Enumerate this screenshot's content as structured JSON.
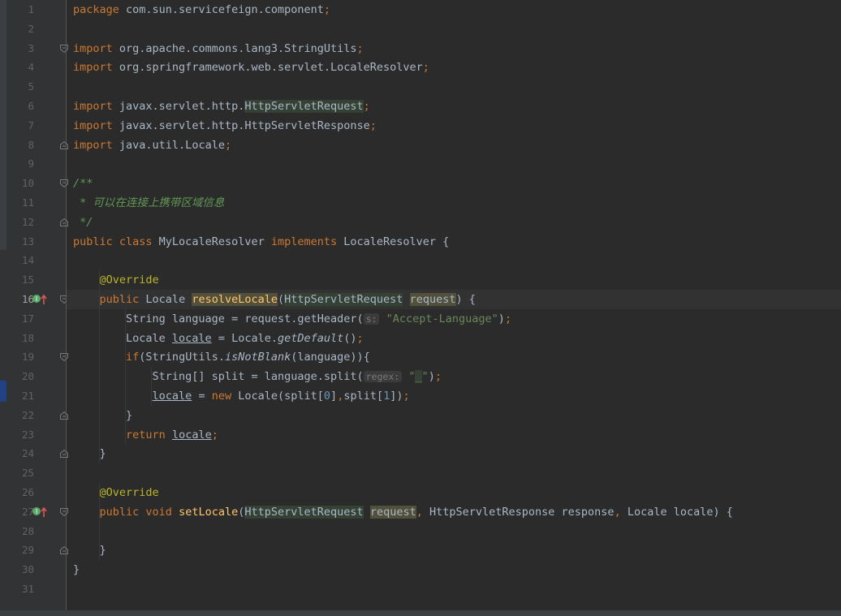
{
  "editor": {
    "current_line": 16,
    "lines": [
      {
        "n": "1",
        "html": "<span class=\"kw\">package</span> com.sun.servicefeign.component<span class=\"kw\">;</span>"
      },
      {
        "n": "2",
        "html": ""
      },
      {
        "n": "3",
        "html": "<span class=\"kw\">import</span> org.apache.commons.lang3.StringUtils<span class=\"kw\">;</span>"
      },
      {
        "n": "4",
        "html": "<span class=\"kw\">import</span> org.springframework.web.servlet.LocaleResolver<span class=\"kw\">;</span>"
      },
      {
        "n": "5",
        "html": ""
      },
      {
        "n": "6",
        "html": "<span class=\"kw\">import</span> javax.servlet.http.<span class=\"hl\">HttpServletRequest</span><span class=\"kw\">;</span>"
      },
      {
        "n": "7",
        "html": "<span class=\"kw\">import</span> javax.servlet.http.HttpServletResponse<span class=\"kw\">;</span>"
      },
      {
        "n": "8",
        "html": "<span class=\"kw\">import</span> java.util.Locale<span class=\"kw\">;</span>"
      },
      {
        "n": "9",
        "html": ""
      },
      {
        "n": "10",
        "html": "<span class=\"doc\">/**</span>"
      },
      {
        "n": "11",
        "html": "<span class=\"doc\"> * 可以在连接上携带区域信息</span>"
      },
      {
        "n": "12",
        "html": "<span class=\"doc\"> */</span>"
      },
      {
        "n": "13",
        "html": "<span class=\"kw\">public class</span> MyLocaleResolver <span class=\"kw\">implements</span> LocaleResolver {"
      },
      {
        "n": "14",
        "html": ""
      },
      {
        "n": "15",
        "html": "    <span class=\"ann\">@Override</span>"
      },
      {
        "n": "16",
        "html": "    <span class=\"kw\">public</span> Locale <span class=\"fn hl2\">resolveLocale</span>(<span class=\"hl\">HttpServletRequest</span> <span class=\"hl2\">request</span>) {"
      },
      {
        "n": "17",
        "html": "        String language = request.getHeader(<span class=\"hint\">s:</span> <span class=\"str\">\"Accept-Language\"</span>)<span class=\"kw\">;</span>"
      },
      {
        "n": "18",
        "html": "        Locale <span class=\"ul\">locale</span> = Locale.<span class=\"it\">getDefault</span>()<span class=\"kw\">;</span>"
      },
      {
        "n": "19",
        "html": "        <span class=\"kw\">if</span>(StringUtils.<span class=\"it\">isNotBlank</span>(language)){"
      },
      {
        "n": "20",
        "html": "            String[] split = language.split(<span class=\"hint\">regex:</span> <span class=\"str\">\"<span class=\"hl\">_</span>\"</span>)<span class=\"kw\">;</span>"
      },
      {
        "n": "21",
        "html": "            <span class=\"ul\">locale</span> = <span class=\"kw\">new</span> Locale(split[<span class=\"num\">0</span>]<span class=\"kw\">,</span>split[<span class=\"num\">1</span>])<span class=\"kw\">;</span>"
      },
      {
        "n": "22",
        "html": "        }"
      },
      {
        "n": "23",
        "html": "        <span class=\"kw\">return</span> <span class=\"ul\">locale</span><span class=\"kw\">;</span>"
      },
      {
        "n": "24",
        "html": "    }"
      },
      {
        "n": "25",
        "html": ""
      },
      {
        "n": "26",
        "html": "    <span class=\"ann\">@Override</span>"
      },
      {
        "n": "27",
        "html": "    <span class=\"kw\">public void</span> <span class=\"fn\">setLocale</span>(<span class=\"hl\">HttpServletRequest</span> <span class=\"hl2\">request</span><span class=\"kw\">,</span> HttpServletResponse response<span class=\"kw\">,</span> Locale locale) {"
      },
      {
        "n": "28",
        "html": ""
      },
      {
        "n": "29",
        "html": "    }"
      },
      {
        "n": "30",
        "html": "}"
      },
      {
        "n": "31",
        "html": ""
      }
    ],
    "fold_markers": [
      {
        "line": 3,
        "kind": "open"
      },
      {
        "line": 8,
        "kind": "close"
      },
      {
        "line": 10,
        "kind": "open"
      },
      {
        "line": 12,
        "kind": "close"
      },
      {
        "line": 16,
        "kind": "open"
      },
      {
        "line": 19,
        "kind": "open"
      },
      {
        "line": 22,
        "kind": "close"
      },
      {
        "line": 24,
        "kind": "close"
      },
      {
        "line": 27,
        "kind": "open"
      },
      {
        "line": 29,
        "kind": "close"
      }
    ],
    "gutter_icons": [
      {
        "line": 16,
        "icon": "implements-method-icon"
      },
      {
        "line": 27,
        "icon": "implements-method-icon"
      }
    ]
  }
}
